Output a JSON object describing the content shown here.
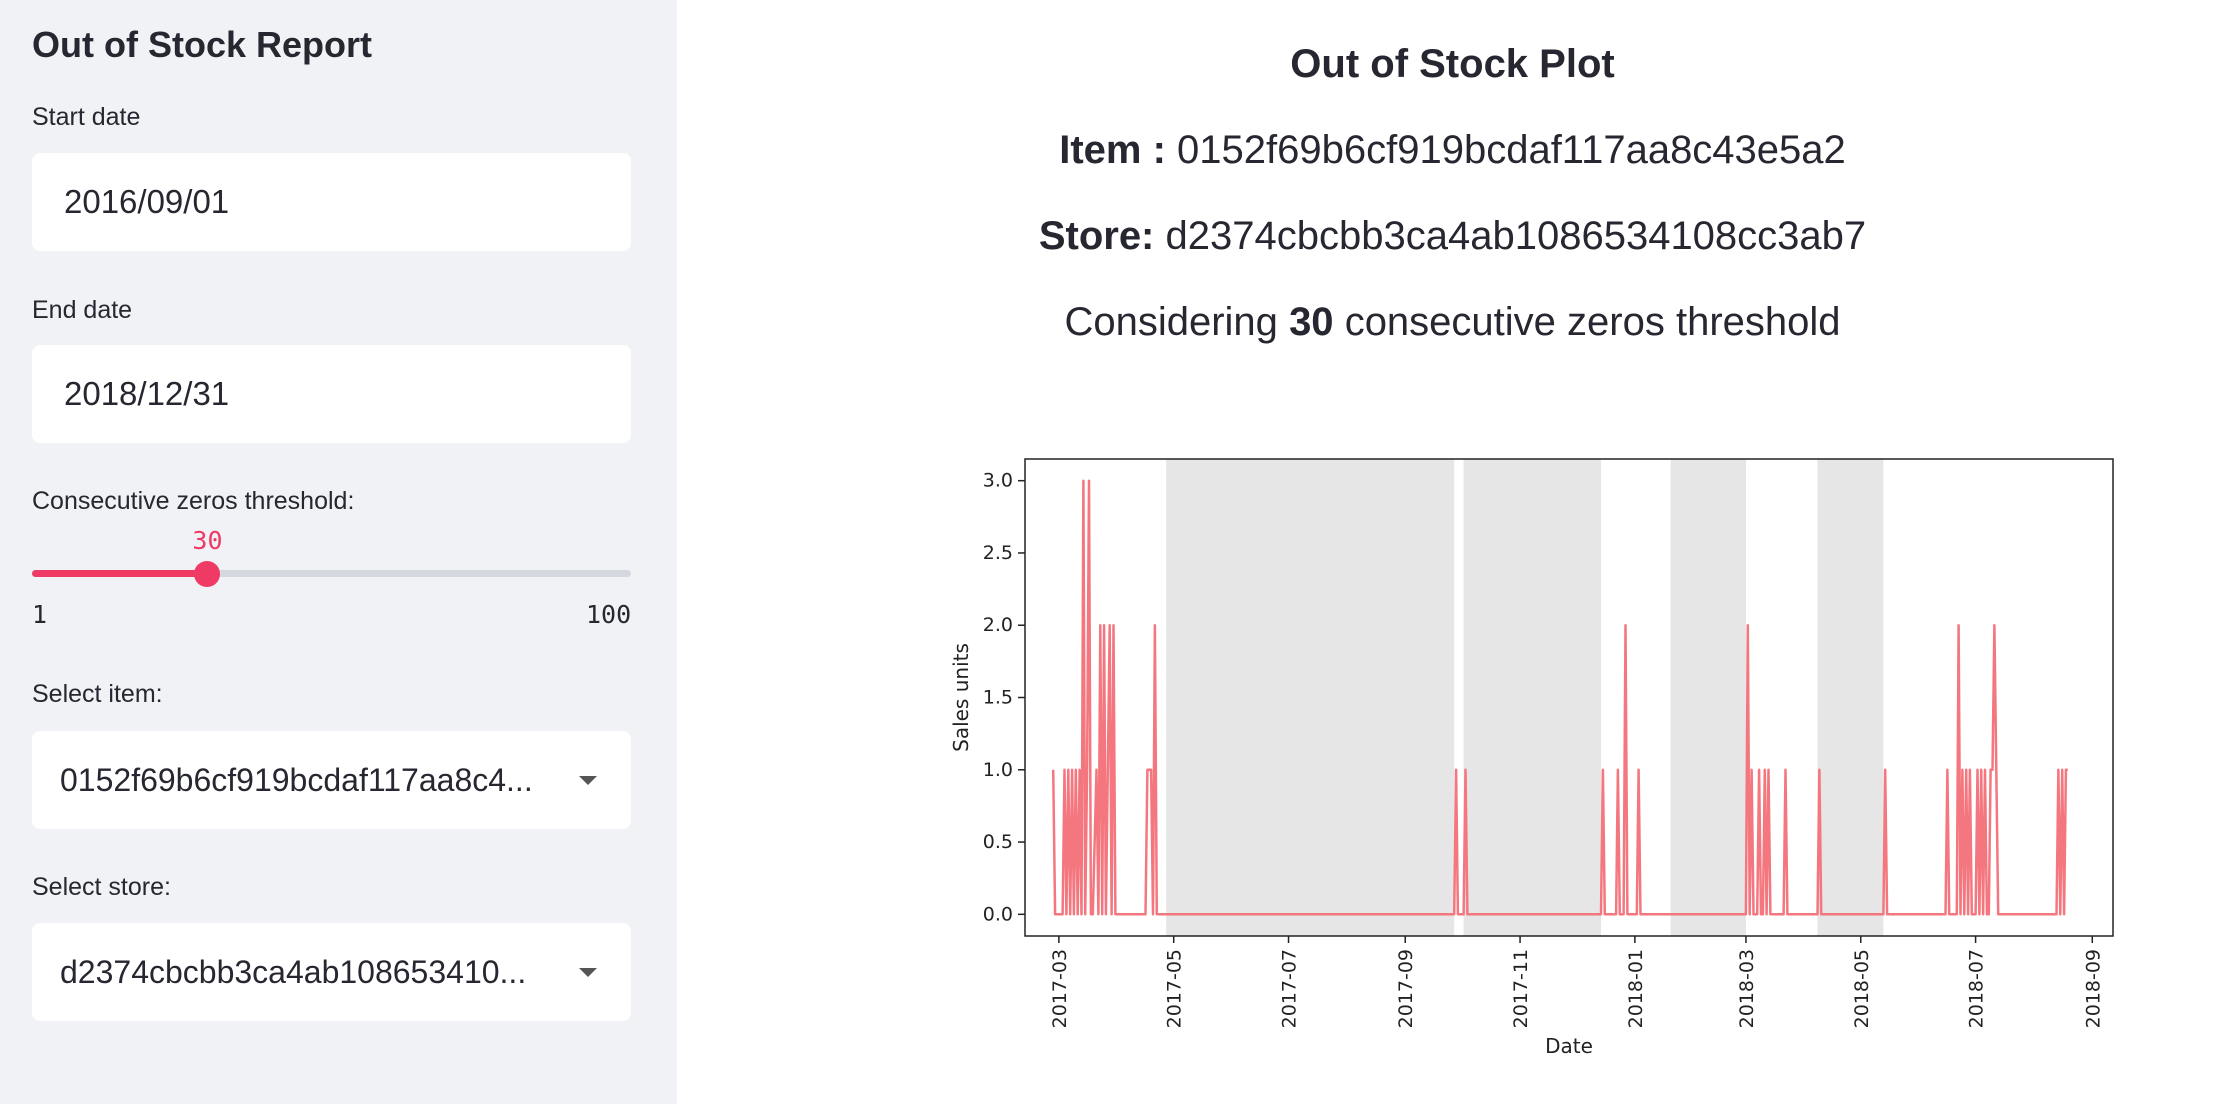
{
  "sidebar": {
    "title": "Out of Stock Report",
    "start_date_label": "Start date",
    "start_date_value": "2016/09/01",
    "end_date_label": "End date",
    "end_date_value": "2018/12/31",
    "threshold_label": "Consecutive zeros threshold:",
    "threshold_value": 30,
    "threshold_min": "1",
    "threshold_max": "100",
    "item_label": "Select item:",
    "item_value": "0152f69b6cf919bcdaf117aa8c4...",
    "store_label": "Select store:",
    "store_value": "d2374cbcbb3ca4ab108653410..."
  },
  "main": {
    "plot_title": "Out of Stock Plot",
    "item_prefix": "Item :",
    "item_id": "0152f69b6cf919bcdaf117aa8c43e5a2",
    "store_prefix": "Store:",
    "store_id": "d2374cbcbb3ca4ab1086534108cc3ab7",
    "considering_prefix": "Considering",
    "considering_value": "30",
    "considering_suffix": "consecutive zeros threshold"
  },
  "colors": {
    "accent": "#ee3a64",
    "line": "#f4777f",
    "shade": "#e6e6e6"
  },
  "chart_data": {
    "type": "line",
    "xlabel": "Date",
    "ylabel": "Sales units",
    "xlim": [
      "2017-02-11",
      "2018-09-12"
    ],
    "ylim": [
      -0.15,
      3.15
    ],
    "yticks": [
      "0.0",
      "0.5",
      "1.0",
      "1.5",
      "2.0",
      "2.5",
      "3.0"
    ],
    "xticks": [
      "2017-03",
      "2017-05",
      "2017-07",
      "2017-09",
      "2017-11",
      "2018-01",
      "2018-03",
      "2018-05",
      "2018-07",
      "2018-09"
    ],
    "xtick_dates": [
      "2017-03-01",
      "2017-05-01",
      "2017-07-01",
      "2017-09-01",
      "2017-11-01",
      "2018-01-01",
      "2018-03-01",
      "2018-05-01",
      "2018-07-01",
      "2018-09-01"
    ],
    "shaded_ranges": [
      [
        "2017-04-27",
        "2017-09-27"
      ],
      [
        "2017-10-02",
        "2017-12-14"
      ],
      [
        "2018-01-20",
        "2018-03-01"
      ],
      [
        "2018-04-08",
        "2018-05-13"
      ]
    ],
    "points": [
      [
        "2017-02-26",
        1
      ],
      [
        "2017-02-27",
        0
      ],
      [
        "2017-03-03",
        0
      ],
      [
        "2017-03-04",
        1
      ],
      [
        "2017-03-05",
        0
      ],
      [
        "2017-03-06",
        1
      ],
      [
        "2017-03-07",
        0
      ],
      [
        "2017-03-08",
        1
      ],
      [
        "2017-03-09",
        0
      ],
      [
        "2017-03-10",
        1
      ],
      [
        "2017-03-11",
        0
      ],
      [
        "2017-03-12",
        1
      ],
      [
        "2017-03-13",
        0
      ],
      [
        "2017-03-14",
        3
      ],
      [
        "2017-03-15",
        0
      ],
      [
        "2017-03-16",
        1
      ],
      [
        "2017-03-17",
        3
      ],
      [
        "2017-03-18",
        0
      ],
      [
        "2017-03-19",
        0
      ],
      [
        "2017-03-21",
        1
      ],
      [
        "2017-03-22",
        0
      ],
      [
        "2017-03-23",
        2
      ],
      [
        "2017-03-24",
        0
      ],
      [
        "2017-03-25",
        2
      ],
      [
        "2017-03-26",
        0
      ],
      [
        "2017-03-27",
        1
      ],
      [
        "2017-03-28",
        2
      ],
      [
        "2017-03-29",
        0
      ],
      [
        "2017-03-30",
        2
      ],
      [
        "2017-03-31",
        0
      ],
      [
        "2017-04-04",
        0
      ],
      [
        "2017-04-05",
        0
      ],
      [
        "2017-04-16",
        0
      ],
      [
        "2017-04-17",
        1
      ],
      [
        "2017-04-19",
        1
      ],
      [
        "2017-04-20",
        0
      ],
      [
        "2017-04-21",
        2
      ],
      [
        "2017-04-22",
        0
      ],
      [
        "2017-09-27",
        0
      ],
      [
        "2017-09-28",
        1
      ],
      [
        "2017-09-29",
        0
      ],
      [
        "2017-10-02",
        0
      ],
      [
        "2017-10-03",
        1
      ],
      [
        "2017-10-04",
        0
      ],
      [
        "2017-12-14",
        0
      ],
      [
        "2017-12-15",
        1
      ],
      [
        "2017-12-16",
        0
      ],
      [
        "2017-12-22",
        0
      ],
      [
        "2017-12-23",
        1
      ],
      [
        "2017-12-24",
        0
      ],
      [
        "2017-12-26",
        0
      ],
      [
        "2017-12-27",
        2
      ],
      [
        "2017-12-28",
        0
      ],
      [
        "2018-01-02",
        0
      ],
      [
        "2018-01-03",
        1
      ],
      [
        "2018-01-04",
        0
      ],
      [
        "2018-03-01",
        0
      ],
      [
        "2018-03-02",
        2
      ],
      [
        "2018-03-03",
        0
      ],
      [
        "2018-03-04",
        1
      ],
      [
        "2018-03-05",
        0
      ],
      [
        "2018-03-07",
        0
      ],
      [
        "2018-03-08",
        1
      ],
      [
        "2018-03-09",
        0
      ],
      [
        "2018-03-10",
        0
      ],
      [
        "2018-03-11",
        1
      ],
      [
        "2018-03-12",
        0
      ],
      [
        "2018-03-13",
        1
      ],
      [
        "2018-03-14",
        0
      ],
      [
        "2018-03-21",
        0
      ],
      [
        "2018-03-22",
        1
      ],
      [
        "2018-03-23",
        0
      ],
      [
        "2018-04-08",
        0
      ],
      [
        "2018-04-09",
        1
      ],
      [
        "2018-04-10",
        0
      ],
      [
        "2018-05-13",
        0
      ],
      [
        "2018-05-14",
        1
      ],
      [
        "2018-05-15",
        0
      ],
      [
        "2018-06-15",
        0
      ],
      [
        "2018-06-16",
        1
      ],
      [
        "2018-06-17",
        0
      ],
      [
        "2018-06-21",
        0
      ],
      [
        "2018-06-22",
        2
      ],
      [
        "2018-06-23",
        0
      ],
      [
        "2018-06-24",
        1
      ],
      [
        "2018-06-25",
        0
      ],
      [
        "2018-06-26",
        1
      ],
      [
        "2018-06-27",
        0
      ],
      [
        "2018-06-28",
        1
      ],
      [
        "2018-06-29",
        0
      ],
      [
        "2018-07-01",
        0
      ],
      [
        "2018-07-02",
        1
      ],
      [
        "2018-07-03",
        0
      ],
      [
        "2018-07-04",
        1
      ],
      [
        "2018-07-05",
        0
      ],
      [
        "2018-07-06",
        1
      ],
      [
        "2018-07-07",
        0
      ],
      [
        "2018-07-08",
        0
      ],
      [
        "2018-07-09",
        1
      ],
      [
        "2018-07-10",
        1
      ],
      [
        "2018-07-11",
        2
      ],
      [
        "2018-07-12",
        1
      ],
      [
        "2018-07-13",
        0
      ],
      [
        "2018-08-13",
        0
      ],
      [
        "2018-08-14",
        1
      ],
      [
        "2018-08-15",
        0
      ],
      [
        "2018-08-16",
        1
      ],
      [
        "2018-08-17",
        0
      ],
      [
        "2018-08-18",
        1
      ],
      [
        "2018-08-19",
        1
      ]
    ]
  }
}
